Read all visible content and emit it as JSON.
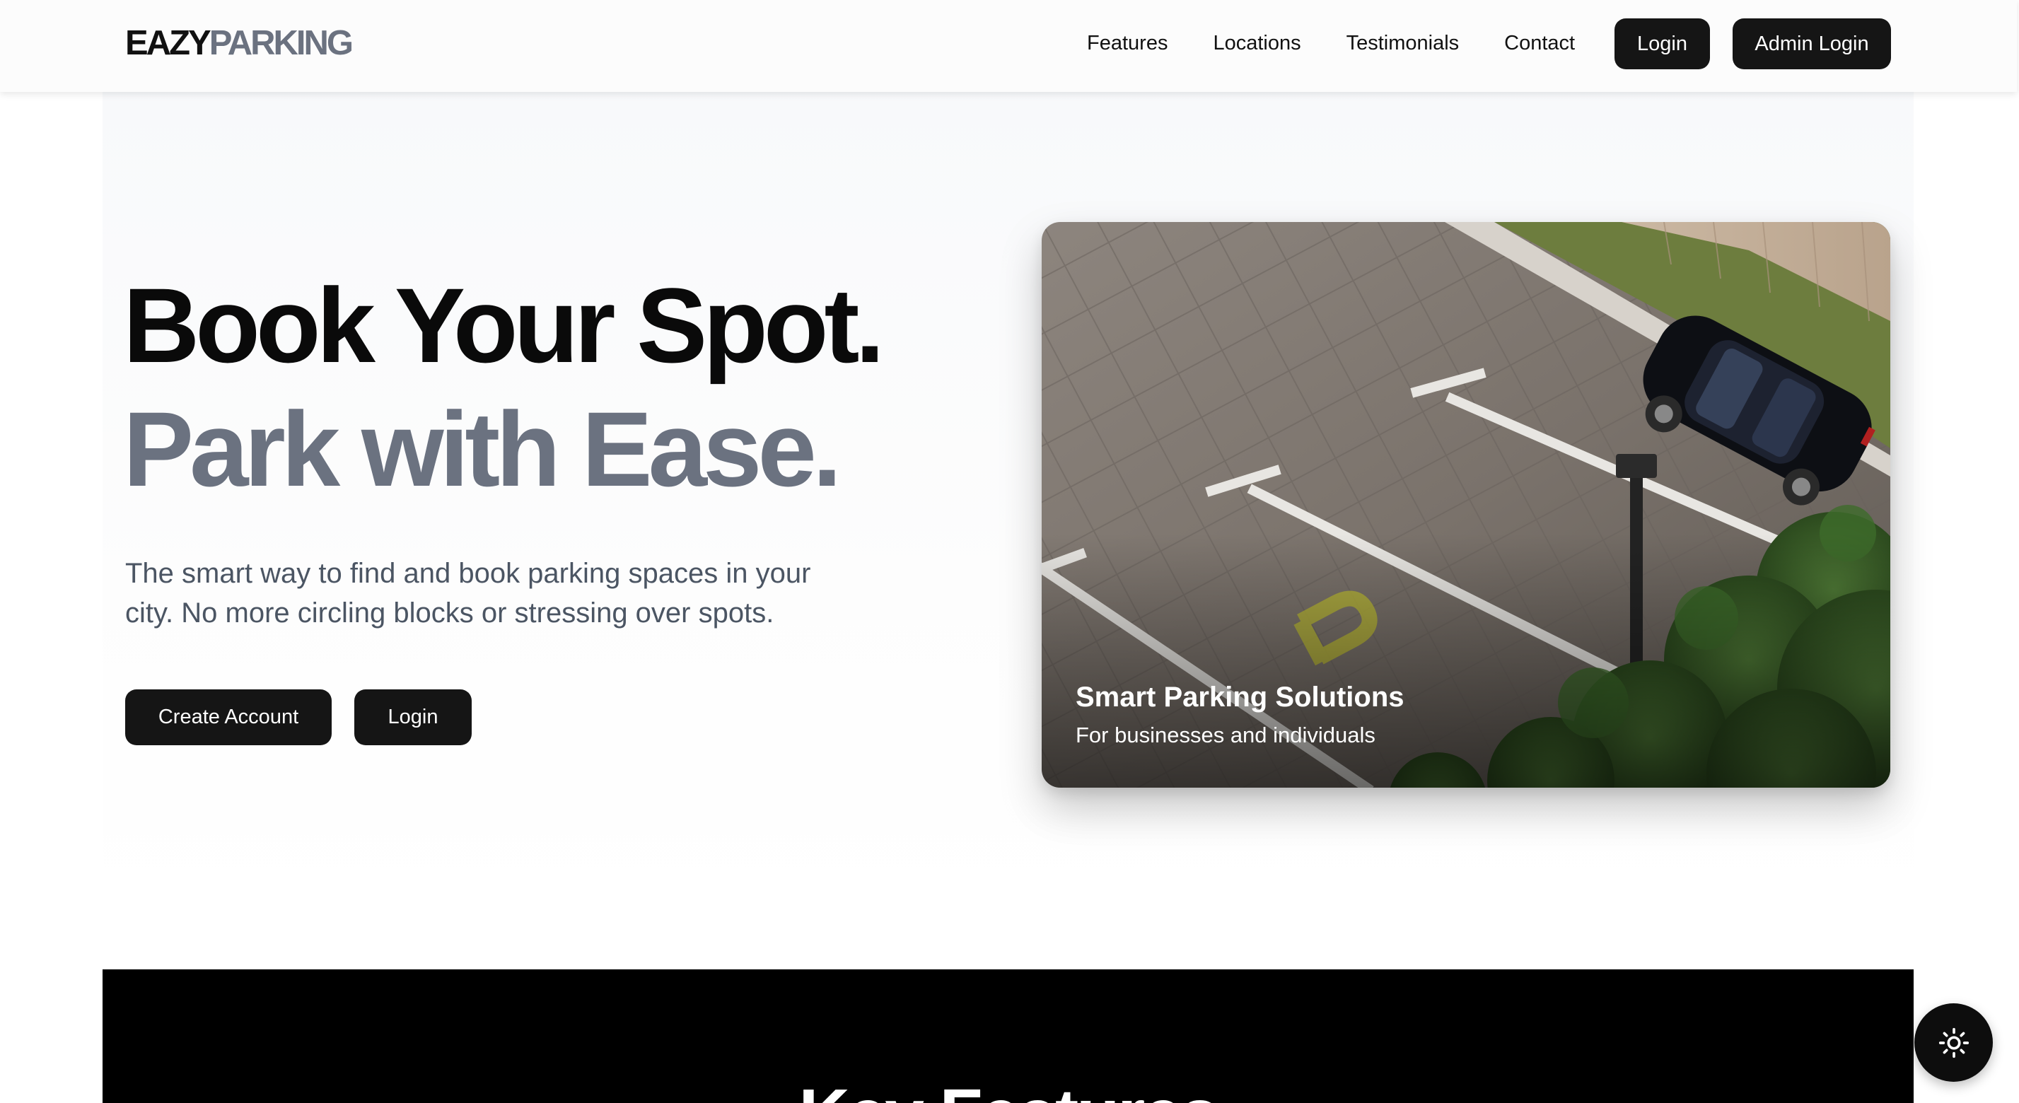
{
  "brand": {
    "part1": "EAZY",
    "part2": "PARKING"
  },
  "nav": {
    "links": [
      "Features",
      "Locations",
      "Testimonials",
      "Contact"
    ],
    "login_label": "Login",
    "admin_login_label": "Admin Login"
  },
  "hero": {
    "headline_line1": "Book Your Spot.",
    "headline_line2": "Park with Ease.",
    "subtext": "The smart way to find and book parking spaces in your city. No more circling blocks or stressing over spots.",
    "create_account_label": "Create Account",
    "login_label": "Login"
  },
  "hero_image": {
    "title": "Smart Parking Solutions",
    "subtitle": "For businesses and individuals"
  },
  "features": {
    "title": "Key Features"
  },
  "theme_toggle": {
    "icon": "sun-icon"
  },
  "colors": {
    "primary_dark": "#151515",
    "brand_gray": "#6b7280",
    "body_text": "#4b5563",
    "hero_bg": "#f8f9fb",
    "features_bg": "#000000"
  }
}
